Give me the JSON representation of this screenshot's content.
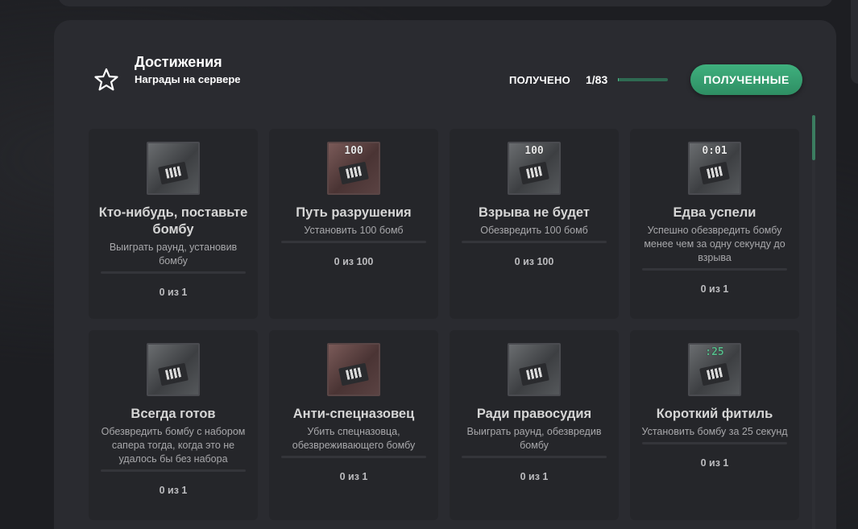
{
  "header": {
    "title": "Достижения",
    "subtitle": "Награды на сервере",
    "received_label": "ПОЛУЧЕНО",
    "received_count": "1/83",
    "received_progress": 0.012,
    "received_button": "ПОЛУЧЕННЫЕ",
    "accent_color": "#3fb07e"
  },
  "achievements": [
    {
      "title": "Кто-нибудь, поставьте бомбу",
      "desc": "Выиграть раунд, установив бомбу",
      "count": "0 из 1",
      "icon": "bomb-plant-icon",
      "screen": ""
    },
    {
      "title": "Путь разрушения",
      "desc": "Установить 100 бомб",
      "count": "0 из 100",
      "icon": "bomb-100-icon",
      "screen": "100"
    },
    {
      "title": "Взрыва не будет",
      "desc": "Обезвредить 100 бомб",
      "count": "0 из 100",
      "icon": "defuse-100-icon",
      "screen": "100"
    },
    {
      "title": "Едва успели",
      "desc": "Успешно обезвредить бомбу менее чем за одну секунду до взрыва",
      "count": "0 из 1",
      "icon": "timer-icon",
      "screen": "0:01"
    },
    {
      "title": "Всегда готов",
      "desc": "Обезвредить бомбу с набором сапера тогда, когда это не удалось бы без набора",
      "count": "0 из 1",
      "icon": "defuse-kit-icon",
      "screen": ""
    },
    {
      "title": "Анти-спецназовец",
      "desc": "Убить спецназовца, обезвреживающего бомбу",
      "count": "0 из 1",
      "icon": "anti-ct-icon",
      "screen": ""
    },
    {
      "title": "Ради правосудия",
      "desc": "Выиграть раунд, обезвредив бомбу",
      "count": "0 из 1",
      "icon": "justice-icon",
      "screen": ""
    },
    {
      "title": "Короткий фитиль",
      "desc": "Установить бомбу за 25 секунд",
      "count": "0 из 1",
      "icon": "short-fuse-icon",
      "screen": ":25"
    }
  ]
}
